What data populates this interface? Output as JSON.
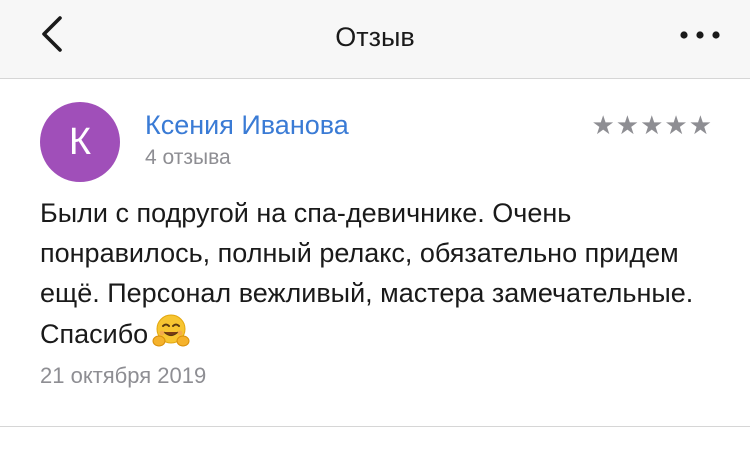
{
  "header": {
    "title": "Отзыв",
    "back_icon": "chevron-left-icon",
    "more_icon": "ellipsis-icon"
  },
  "review": {
    "avatar_letter": "К",
    "avatar_color": "#a04fb9",
    "author_name": "Ксения Иванова",
    "author_color": "#3a7bd5",
    "reviews_count": "4 отзыва",
    "rating": 5,
    "rating_max": 5,
    "star_color": "#8e8e93",
    "text": "Были с подругой на спа-девичнике. Очень понравилось, полный релакс, обязательно придем ещё. Персонал вежливый, мастера замечательные. Спасибо",
    "emoji_icon": "hugging-face-emoji",
    "date": "21 октября 2019"
  }
}
